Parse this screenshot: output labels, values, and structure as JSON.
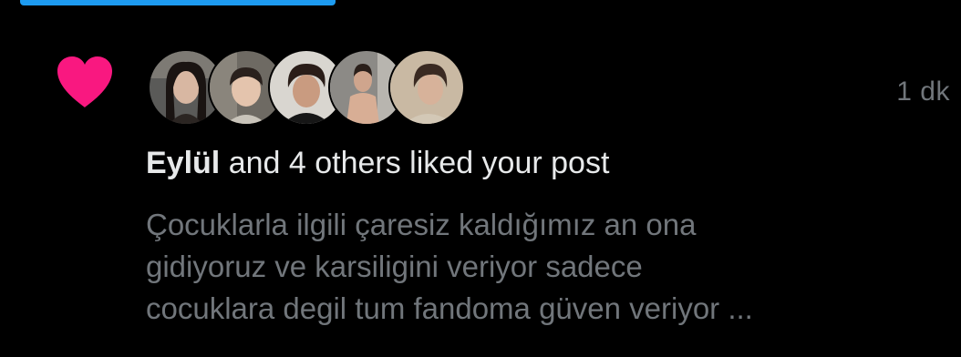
{
  "notification": {
    "liker_name": "Eylül",
    "action_text": "and 4 others liked your post",
    "timestamp": "1 dk",
    "post_preview_lines": [
      "Çocuklarla ilgili çaresiz kaldığımız an ona",
      "gidiyoruz ve karsiligini veriyor sadece",
      "cocuklara degil tum fandoma güven veriyor ..."
    ],
    "icon": "heart-icon",
    "avatar_count": 5
  },
  "colors": {
    "background": "#000000",
    "heart": "#f91880",
    "primary_text": "#e7e9ea",
    "secondary_text": "#71767b",
    "accent": "#1d9bf0"
  }
}
